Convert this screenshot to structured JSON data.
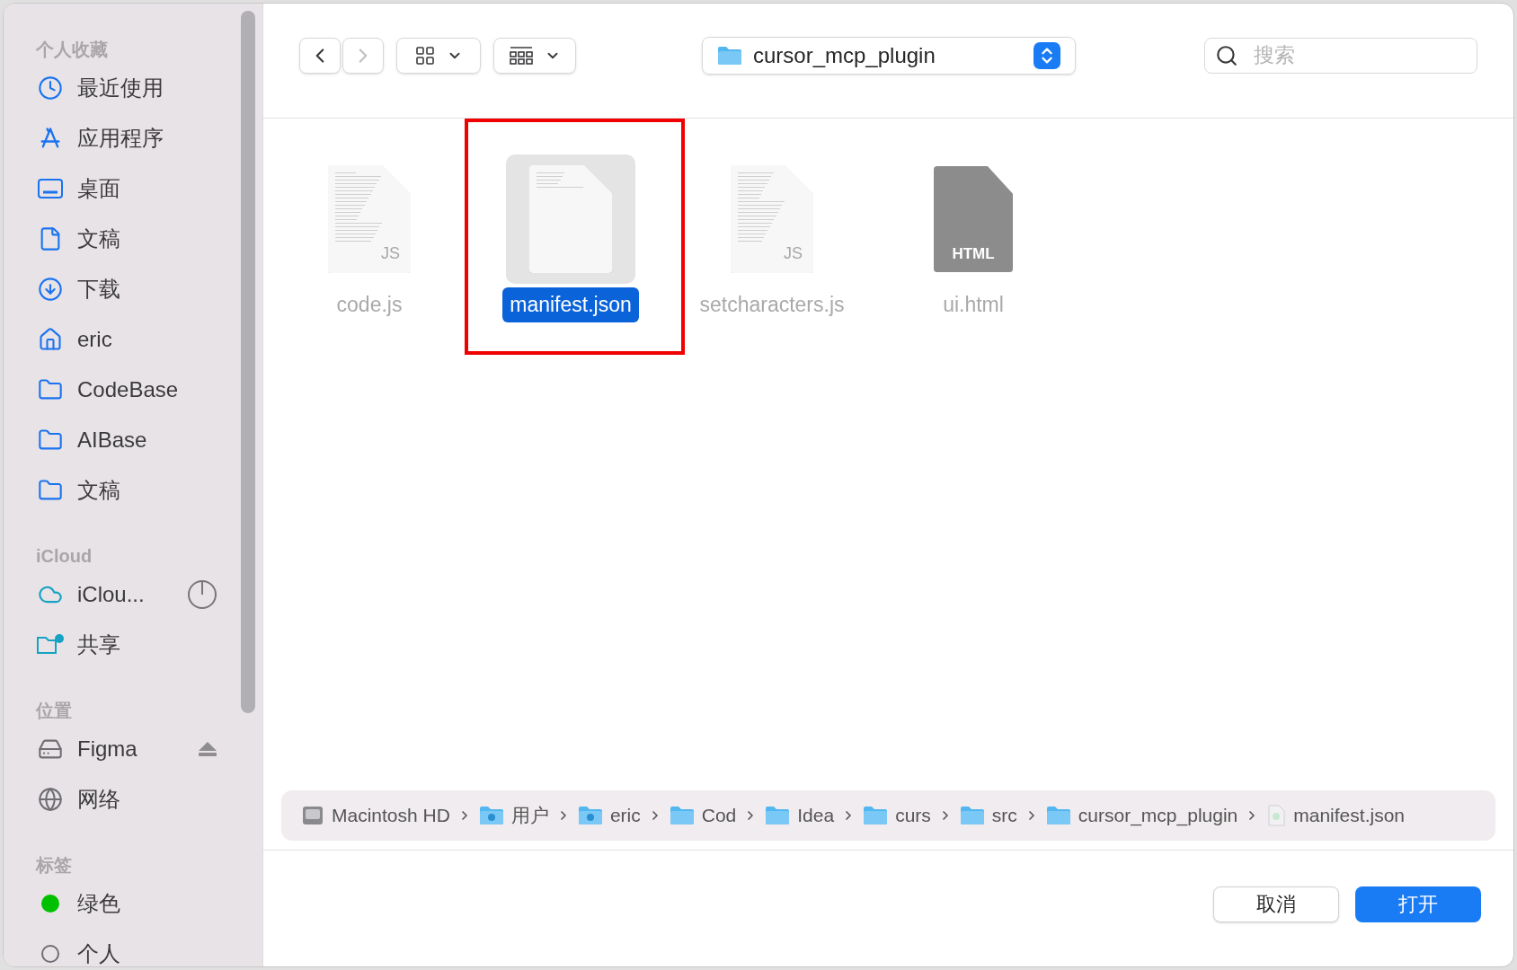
{
  "sidebar": {
    "sections": [
      {
        "title": "个人收藏",
        "items": [
          {
            "label": "最近使用",
            "kind": "clock"
          },
          {
            "label": "应用程序",
            "kind": "apps"
          },
          {
            "label": "桌面",
            "kind": "desktop"
          },
          {
            "label": "文稿",
            "kind": "document"
          },
          {
            "label": "下载",
            "kind": "download"
          },
          {
            "label": "eric",
            "kind": "home"
          },
          {
            "label": "CodeBase",
            "kind": "folder"
          },
          {
            "label": "AIBase",
            "kind": "folder"
          },
          {
            "label": "文稿",
            "kind": "folder"
          }
        ]
      },
      {
        "title": "iCloud",
        "items": [
          {
            "label": "iClou...",
            "kind": "cloud"
          },
          {
            "label": "共享",
            "kind": "shared"
          }
        ]
      },
      {
        "title": "位置",
        "items": [
          {
            "label": "Figma",
            "kind": "volume"
          },
          {
            "label": "网络",
            "kind": "network"
          }
        ]
      },
      {
        "title": "标签",
        "items": [
          {
            "label": "绿色",
            "kind": "tag",
            "color": "#00c000"
          },
          {
            "label": "个人",
            "kind": "ring",
            "color": "#6e6e73"
          }
        ]
      }
    ]
  },
  "toolbar": {
    "back_disabled": false,
    "forward_disabled": true,
    "location": "cursor_mcp_plugin",
    "search": {
      "placeholder": "搜索"
    }
  },
  "files": [
    {
      "name": "code.js",
      "kind": "code",
      "badge": "JS",
      "selected": false,
      "annotated": false
    },
    {
      "name": "manifest.json",
      "kind": "plain",
      "selected": true,
      "annotated": true
    },
    {
      "name": "setcharacters.js",
      "kind": "code",
      "badge": "JS",
      "selected": false,
      "annotated": false
    },
    {
      "name": "ui.html",
      "kind": "dark",
      "badge": "HTML",
      "selected": false,
      "annotated": false
    }
  ],
  "path_bar": [
    {
      "label": "Macintosh HD",
      "kind": "disk"
    },
    {
      "label": "用户",
      "kind": "user-folder"
    },
    {
      "label": "eric",
      "kind": "home-folder"
    },
    {
      "label": "Cod",
      "kind": "folder"
    },
    {
      "label": "Idea",
      "kind": "folder"
    },
    {
      "label": "curs",
      "kind": "folder"
    },
    {
      "label": "src",
      "kind": "folder"
    },
    {
      "label": "cursor_mcp_plugin",
      "kind": "folder"
    },
    {
      "label": "manifest.json",
      "kind": "file"
    }
  ],
  "buttons": [
    {
      "label": "取消",
      "kind": "secondary"
    },
    {
      "label": "打开",
      "kind": "primary"
    }
  ]
}
